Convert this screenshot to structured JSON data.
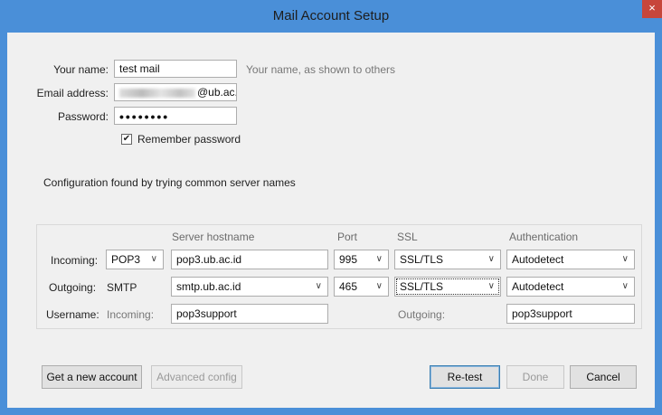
{
  "window": {
    "title": "Mail Account Setup",
    "close_glyph": "×"
  },
  "form": {
    "name_label": "Your name:",
    "name_value": "test mail",
    "name_hint": "Your name, as shown to others",
    "email_label": "Email address:",
    "email_domain": "@ub.ac.id",
    "password_label": "Password:",
    "password_value": "••••••••",
    "remember_label": "Remember password",
    "remember_checked": true
  },
  "status": "Configuration found by trying common server names",
  "servers": {
    "headers": {
      "hostname": "Server hostname",
      "port": "Port",
      "ssl": "SSL",
      "auth": "Authentication"
    },
    "incoming": {
      "label": "Incoming:",
      "protocol": "POP3",
      "hostname": "pop3.ub.ac.id",
      "port": "995",
      "ssl": "SSL/TLS",
      "auth": "Autodetect"
    },
    "outgoing": {
      "label": "Outgoing:",
      "protocol": "SMTP",
      "hostname": "smtp.ub.ac.id",
      "port": "465",
      "ssl": "SSL/TLS",
      "auth": "Autodetect"
    },
    "username": {
      "label": "Username:",
      "incoming_label": "Incoming:",
      "incoming_value": "pop3support",
      "outgoing_label": "Outgoing:",
      "outgoing_value": "pop3support"
    }
  },
  "buttons": {
    "get_account": "Get a new account",
    "advanced": "Advanced config",
    "retest": "Re-test",
    "done": "Done",
    "cancel": "Cancel"
  },
  "icons": {
    "dropdown": "chevron-down-icon",
    "check": "checkmark-icon",
    "close": "close-icon"
  },
  "colors": {
    "titlebar": "#4a8fd8",
    "close": "#c7463b",
    "background": "#f0f0f0"
  }
}
